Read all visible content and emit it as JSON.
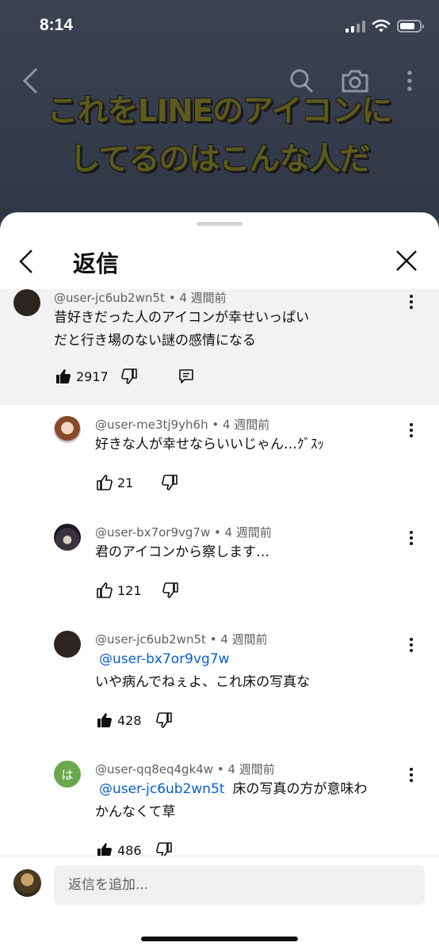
{
  "status_bar": {
    "time": "8:14"
  },
  "video": {
    "caption_line1": "これをLINEのアイコンに",
    "caption_line2": "してるのはこんな人だ"
  },
  "sheet": {
    "title": "返信"
  },
  "parent_comment": {
    "author": "@user-jc6ub2wn5t",
    "time": "4 週間前",
    "text_line1": "昔好きだった人のアイコンが幸せいっぱい",
    "text_line2": "だと行き場のない謎の感情になる",
    "likes": "2917",
    "liked": true
  },
  "replies": [
    {
      "author": "@user-me3tj9yh6h",
      "time": "4 週間前",
      "mention": "",
      "text_line1": "好きな人が幸せならいいじゃん…ｸﾞｽｯ",
      "text_line2": "",
      "likes": "21",
      "liked": false,
      "avatar": "anime-avatar"
    },
    {
      "author": "@user-bx7or9vg7w",
      "time": "4 週間前",
      "mention": "",
      "text_line1": "君のアイコンから察します…",
      "text_line2": "",
      "likes": "121",
      "liked": false,
      "avatar": "scene-avatar"
    },
    {
      "author": "@user-jc6ub2wn5t",
      "time": "4 週間前",
      "mention": "@user-bx7or9vg7w",
      "text_line1": "いや病んでねぇよ、これ床の写真な",
      "text_line2": "",
      "likes": "428",
      "liked": true,
      "avatar": "dark-avatar"
    },
    {
      "author": "@user-qq8eq4gk4w",
      "time": "4 週間前",
      "mention": "@user-jc6ub2wn5t",
      "text_line1": "床の写真の方が意味わ",
      "text_line2": "かんなくて草",
      "likes": "486",
      "liked": true,
      "avatar": "initial-avatar",
      "avatar_initial": "は",
      "avatar_color": "#6aa84f"
    }
  ],
  "composer": {
    "placeholder": "返信を追加..."
  },
  "colors": {
    "mention": "#065fd4",
    "parent_bg": "#f2f2f2",
    "meta": "#606060"
  }
}
